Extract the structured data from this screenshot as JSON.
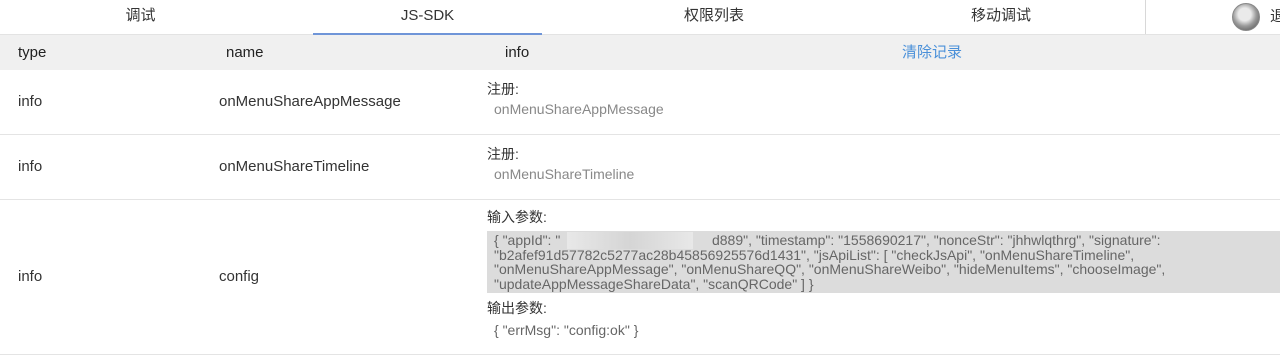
{
  "tabs": [
    {
      "label": "调试"
    },
    {
      "label": "JS-SDK"
    },
    {
      "label": "权限列表"
    },
    {
      "label": "移动调试"
    }
  ],
  "user": {
    "logout_label": "退"
  },
  "table": {
    "headers": {
      "type": "type",
      "name": "name",
      "info": "info",
      "clear": "清除记录"
    },
    "rows": [
      {
        "type": "info",
        "name": "onMenuShareAppMessage",
        "info_title": "注册:",
        "info_value": "onMenuShareAppMessage"
      },
      {
        "type": "info",
        "name": "onMenuShareTimeline",
        "info_title": "注册:",
        "info_value": "onMenuShareTimeline"
      },
      {
        "type": "info",
        "name": "config",
        "input_title": "输入参数:",
        "input_line1": "{ \"appId\": \"                                       d889\", \"timestamp\": \"1558690217\", \"nonceStr\": \"jhhwlqthrg\", \"signature\":",
        "input_line2": "\"b2afef91d57782c5277ac28b45856925576d1431\", \"jsApiList\": [ \"checkJsApi\", \"onMenuShareTimeline\",",
        "input_line3": "\"onMenuShareAppMessage\", \"onMenuShareQQ\", \"onMenuShareWeibo\", \"hideMenuItems\", \"chooseImage\",",
        "input_line4": "\"updateAppMessageShareData\", \"scanQRCode\" ] }",
        "output_title": "输出参数:",
        "output_value": "{ \"errMsg\": \"config:ok\" }"
      }
    ]
  },
  "colors": {
    "accent": "#6f95d8",
    "link": "#4a90d9",
    "header_bg": "#f0f0f0",
    "code_bg": "#dcdcdc"
  }
}
